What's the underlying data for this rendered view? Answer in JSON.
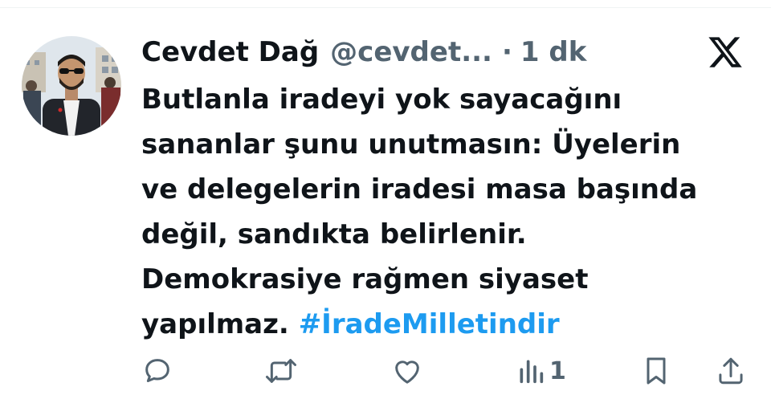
{
  "tweet": {
    "author": {
      "display_name": "Cevdet Dağ",
      "handle": "@cevdet...",
      "separator": "·",
      "time": "1 dk"
    },
    "text_lines": [
      "Butlanla iradeyi yok sayacağını",
      "sananlar şunu unutmasın: Üyelerin",
      "ve delegelerin iradesi masa başında",
      "değil, sandıkta belirlenir.",
      "Demokrasiye rağmen siyaset"
    ],
    "last_line_text": "yapılmaz.",
    "hashtag": "#İradeMilletindir"
  },
  "actions": {
    "views_count": "1",
    "icons": [
      "reply-icon",
      "retweet-icon",
      "like-icon",
      "views-icon",
      "bookmark-icon",
      "share-icon"
    ]
  },
  "colors": {
    "text": "#0f1419",
    "muted": "#536471",
    "hashtag": "#1d9bf0",
    "background": "#ffffff"
  }
}
